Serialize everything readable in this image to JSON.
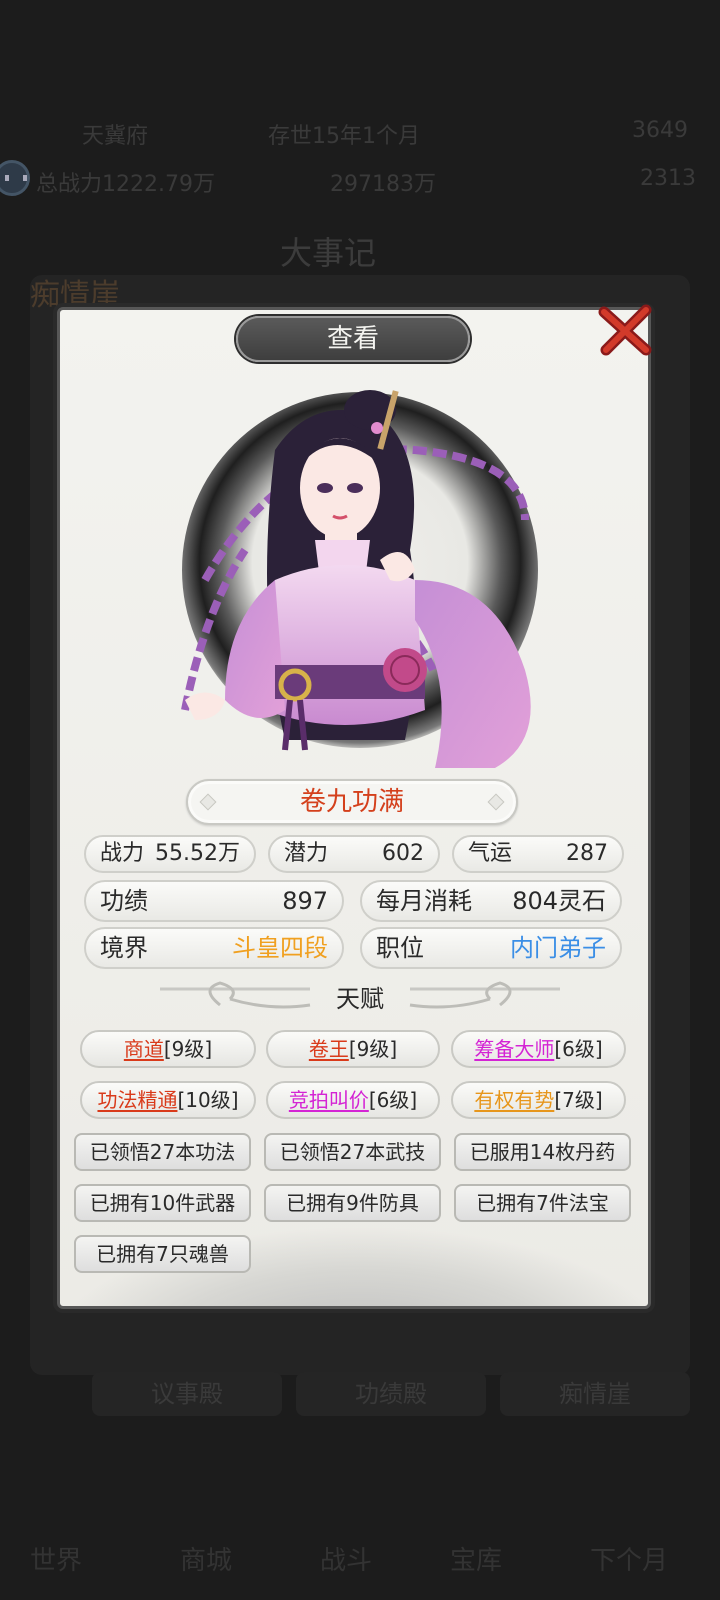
{
  "background": {
    "top_row_1": {
      "place": "天冀府",
      "time": "存世15年1个月",
      "value": "3649"
    },
    "top_row_2": {
      "power": "总战力1222.79万",
      "resource": "297183万",
      "value": "2313"
    },
    "panel_title": "大事记",
    "badge": "痴情崖",
    "tabs": [
      "议事殿",
      "功绩殿",
      "痴情崖"
    ],
    "nav": [
      "世界",
      "商城",
      "战斗",
      "宝库",
      "下个月"
    ]
  },
  "modal": {
    "title": "查看",
    "name": "卷九功满",
    "stats": {
      "combat": {
        "label": "战力",
        "value": "55.52万"
      },
      "potential": {
        "label": "潜力",
        "value": "602"
      },
      "luck": {
        "label": "气运",
        "value": "287"
      },
      "merit": {
        "label": "功绩",
        "value": "897"
      },
      "upkeep": {
        "label": "每月消耗",
        "value": "804灵石"
      },
      "realm": {
        "label": "境界",
        "value": "斗皇四段"
      },
      "position": {
        "label": "职位",
        "value": "内门弟子"
      }
    },
    "talent_title": "天赋",
    "talents": [
      {
        "name": "商道",
        "level": "[9级]",
        "color": "red"
      },
      {
        "name": "卷王",
        "level": "[9级]",
        "color": "red"
      },
      {
        "name": "筹备大师",
        "level": "[6级]",
        "color": "magenta"
      },
      {
        "name": "功法精通",
        "level": "[10级]",
        "color": "red"
      },
      {
        "name": "竞拍叫价",
        "level": "[6级]",
        "color": "magenta"
      },
      {
        "name": "有权有势",
        "level": "[7级]",
        "color": "orange"
      }
    ],
    "achievements": [
      "已领悟27本功法",
      "已领悟27本武技",
      "已服用14枚丹药",
      "已拥有10件武器",
      "已拥有9件防具",
      "已拥有7件法宝",
      "已拥有7只魂兽"
    ]
  },
  "colors": {
    "name": "#d4401c",
    "realm": "#f0a020",
    "position": "#3a8ee6"
  }
}
